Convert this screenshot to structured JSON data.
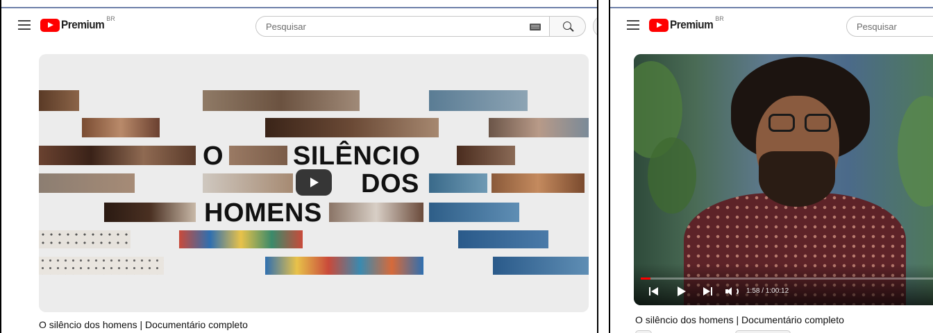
{
  "colors": {
    "brand_red": "#ff0000",
    "progress": "#ff0000"
  },
  "left": {
    "logo": {
      "text": "Premium",
      "country": "BR"
    },
    "search": {
      "placeholder": "Pesquisar"
    },
    "thumbnail": {
      "words": {
        "o": "O",
        "silencio": "SILÊNCIO",
        "dos": "DOS",
        "homens": "HOMENS"
      }
    },
    "video_title": "O silêncio dos homens | Documentário completo"
  },
  "right": {
    "logo": {
      "text": "Premium",
      "country": "BR"
    },
    "search": {
      "placeholder": "Pesquisar"
    },
    "player": {
      "current_time": "1:58",
      "duration": "1:00:12",
      "time_display": "1:58 / 1:00:12",
      "progress_fraction": 0.033
    },
    "video_title": "O silêncio dos homens | Documentário completo"
  },
  "icons": [
    "menu-icon",
    "youtube-logo-icon",
    "keyboard-icon",
    "search-icon",
    "play-icon",
    "previous-icon",
    "next-icon",
    "volume-icon"
  ]
}
